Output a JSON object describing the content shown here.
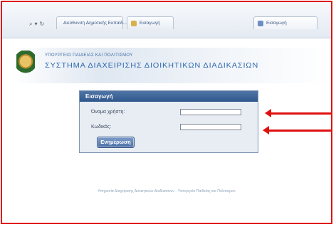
{
  "browser": {
    "nav": {
      "search_glyph": "⌕",
      "dropdown_glyph": "▾",
      "refresh_glyph": "↻"
    },
    "tabs": [
      {
        "label": "Διεύθυνση Δημοτικής Εκπαίδ...",
        "icon": "site-green-icon"
      },
      {
        "label": "Εισαγωγή",
        "icon": "page-icon"
      },
      {
        "label": "Εισαγωγή",
        "icon": "page-icon"
      }
    ]
  },
  "banner": {
    "ministry": "ΥΠΟΥΡΓΕΙΟ ΠΑΙΔΕΙΑΣ ΚΑΙ ΠΟΛΙΤΙΣΜΟΥ",
    "system_title": "ΣΥΣΤΗΜΑ ΔΙΑΧΕΙΡΙΣΗΣ ΔΙΟΙΚΗΤΙΚΩΝ ΔΙΑΔΙΚΑΣΙΩΝ"
  },
  "login": {
    "header": "Εισαγωγή",
    "username_label": "Όνομα χρήστη:",
    "username_value": "",
    "password_label": "Κωδικός:",
    "password_value": "",
    "submit_label": "Ενημέρωση"
  },
  "footer": "Υπηρεσία Διαχείρισης Διοικητικών Διαδικασιών - Υπουργείο Παιδείας και Πολιτισμού",
  "colors": {
    "annotation": "#e01010",
    "panel_header": "#2f578c",
    "title_blue": "#2f6ab0"
  }
}
